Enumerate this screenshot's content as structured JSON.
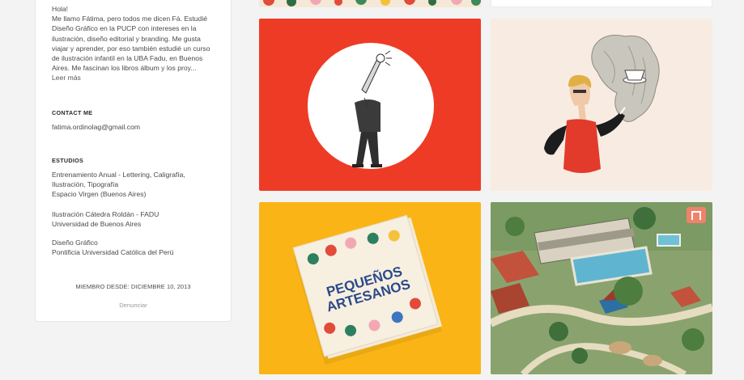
{
  "profile": {
    "bio": "Hola!\nMe llamo Fátima, pero todos me dicen Fá. Estudié Diseño Gráfico en la PUCP con intereses en la ilustración, diseño editorial y branding. Me gusta viajar y aprender, por eso también estudié un curso de ilustración infantil en la UBA Fadu, en Buenos Aires. Me fascinan los libros álbum y los proy...",
    "bio_lines": [
      "Hola!",
      "Me llamo Fátima, pero todos me dicen Fá. Estudié",
      "Diseño Gráfico en la PUCP con intereses en la",
      "ilustración, diseño editorial y branding. Me gusta",
      "viajar y aprender, por eso también estudié un curso",
      "de ilustración infantil en la UBA Fadu, en Buenos",
      "Aires. Me fascinan los libros álbum y los proy..."
    ],
    "read_more": "Leer más",
    "contact_title": "CONTACT ME",
    "email": "fatima.ordinolag@gmail.com",
    "studies_title": "ESTUDIOS",
    "studies": [
      [
        "Entrenamiento Anual - Lettering, Caligrafía,",
        "Ilustración, Tipografía",
        "Espacio Virgen (Buenos Aires)"
      ],
      [
        "Ilustración Cátedra Roldán - FADU",
        "Universidad de Buenos Aires"
      ],
      [
        "Diseño Gráfico",
        "Pontificia Universidad Católica del Perú"
      ]
    ],
    "member_since": "MIEMBRO DESDE: DICIEMBRE 10, 2013",
    "report": "Denunciar"
  },
  "projects": {
    "book_title_line1": "PEQUEÑOS",
    "book_title_line2": "ARTESANOS",
    "colors": {
      "red_bg": "#ee3b25",
      "yellow_bg": "#fbb415",
      "cream_bg": "#f8ece2"
    }
  }
}
